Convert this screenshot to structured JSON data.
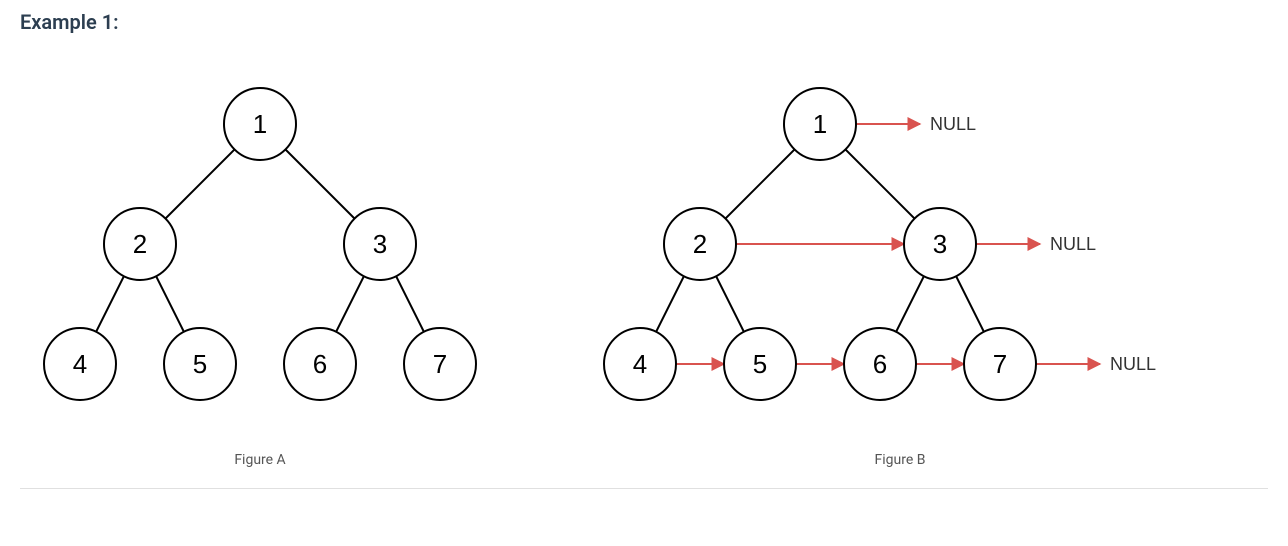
{
  "title": "Example 1:",
  "null_label": "NULL",
  "figA": {
    "caption": "Figure A",
    "nodes": [
      {
        "id": "a1",
        "label": "1"
      },
      {
        "id": "a2",
        "label": "2"
      },
      {
        "id": "a3",
        "label": "3"
      },
      {
        "id": "a4",
        "label": "4"
      },
      {
        "id": "a5",
        "label": "5"
      },
      {
        "id": "a6",
        "label": "6"
      },
      {
        "id": "a7",
        "label": "7"
      }
    ]
  },
  "figB": {
    "caption": "Figure B",
    "nodes": [
      {
        "id": "b1",
        "label": "1"
      },
      {
        "id": "b2",
        "label": "2"
      },
      {
        "id": "b3",
        "label": "3"
      },
      {
        "id": "b4",
        "label": "4"
      },
      {
        "id": "b5",
        "label": "5"
      },
      {
        "id": "b6",
        "label": "6"
      },
      {
        "id": "b7",
        "label": "7"
      }
    ],
    "pointers_next": [
      [
        "b1",
        "NULL"
      ],
      [
        "b2",
        "b3"
      ],
      [
        "b3",
        "NULL"
      ],
      [
        "b4",
        "b5"
      ],
      [
        "b5",
        "b6"
      ],
      [
        "b6",
        "b7"
      ],
      [
        "b7",
        "NULL"
      ]
    ]
  }
}
